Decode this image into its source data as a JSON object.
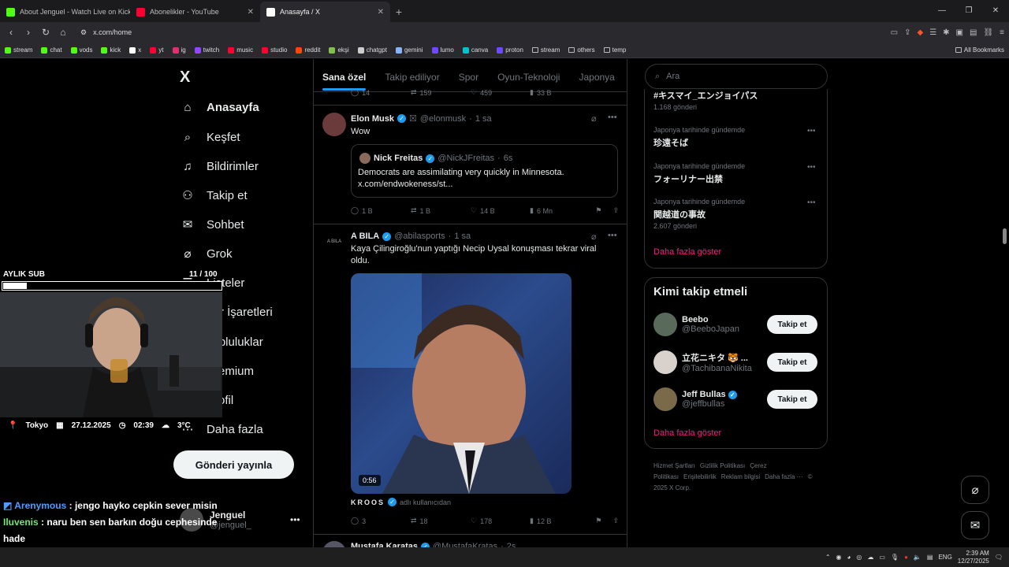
{
  "browser": {
    "tabs": [
      {
        "title": "About Jenguel - Watch Live on Kick",
        "color": "#53fc18"
      },
      {
        "title": "Abonelikler - YouTube",
        "color": "#ff0033"
      },
      {
        "title": "Anasayfa / X",
        "color": "#ffffff"
      }
    ],
    "active_tab_index": 2,
    "url": "x.com/home",
    "bookmarks": [
      {
        "label": "stream",
        "color": "#53fc18"
      },
      {
        "label": "chat",
        "color": "#53fc18"
      },
      {
        "label": "vods",
        "color": "#53fc18"
      },
      {
        "label": "kick",
        "color": "#53fc18"
      },
      {
        "label": "x",
        "color": "#ffffff"
      },
      {
        "label": "yt",
        "color": "#ff0033"
      },
      {
        "label": "ig",
        "color": "#e1306c"
      },
      {
        "label": "twitch",
        "color": "#9146ff"
      },
      {
        "label": "music",
        "color": "#ff0033"
      },
      {
        "label": "studio",
        "color": "#ff0033"
      },
      {
        "label": "reddit",
        "color": "#ff4500"
      },
      {
        "label": "ekşi",
        "color": "#81c14b"
      },
      {
        "label": "chatgpt",
        "color": "#cccccc"
      },
      {
        "label": "gemini",
        "color": "#8ab4f8"
      },
      {
        "label": "lumo",
        "color": "#6d4aff"
      },
      {
        "label": "canva",
        "color": "#00c4cc"
      },
      {
        "label": "proton",
        "color": "#6d4aff"
      }
    ],
    "folders": [
      "stream",
      "others",
      "temp"
    ],
    "all_bookmarks": "All Bookmarks"
  },
  "sidebar": {
    "logo": "X",
    "items": [
      {
        "label": "Anasayfa",
        "icon": "home-icon",
        "glyph": "⌂"
      },
      {
        "label": "Keşfet",
        "icon": "search-icon",
        "glyph": "⌕"
      },
      {
        "label": "Bildirimler",
        "icon": "bell-icon",
        "glyph": "♫"
      },
      {
        "label": "Takip et",
        "icon": "follow-icon",
        "glyph": "⚇"
      },
      {
        "label": "Sohbet",
        "icon": "mail-icon",
        "glyph": "✉"
      },
      {
        "label": "Grok",
        "icon": "grok-icon",
        "glyph": "⌀"
      },
      {
        "label": "Listeler",
        "icon": "list-icon",
        "glyph": "☰"
      },
      {
        "label": "Yer İşaretleri",
        "icon": "bookmark-icon",
        "glyph": "⚑"
      },
      {
        "label": "Topluluklar",
        "icon": "communities-icon",
        "glyph": "⚉"
      },
      {
        "label": "Premium",
        "icon": "premium-icon",
        "glyph": "X"
      },
      {
        "label": "Profil",
        "icon": "profile-icon",
        "glyph": "☺"
      },
      {
        "label": "Daha fazla",
        "icon": "more-icon",
        "glyph": "⋯"
      }
    ],
    "post_button": "Gönderi yayınla",
    "account": {
      "name": "Jenguel",
      "handle": "@jenguel_"
    }
  },
  "feed": {
    "tabs": [
      "Sana özel",
      "Takip ediliyor",
      "Spor",
      "Oyun-Teknoloji",
      "Japonya"
    ],
    "prev_actions": {
      "replies": "14",
      "reposts": "159",
      "likes": "459",
      "views": "33 B"
    },
    "tweets": [
      {
        "name": "Elon Musk",
        "handle": "@elonmusk",
        "time": "1 sa",
        "text": "Wow",
        "quote": {
          "name": "Nick Freitas",
          "handle": "@NickJFreitas",
          "time": "6s",
          "text": "Democrats are assimilating very quickly in Minnesota. x.com/endwokeness/st..."
        },
        "actions": {
          "replies": "1 B",
          "reposts": "1 B",
          "likes": "14 B",
          "views": "6 Mn"
        }
      },
      {
        "name": "A BILA",
        "handle": "@abilasports",
        "time": "1 sa",
        "text": "Kaya Çilingiroğlu'nun yaptığı Necip Uysal konuşması tekrar viral oldu.",
        "video_duration": "0:56",
        "attribution_name": "KROOS",
        "attribution_suffix": "adlı kullanıcıdan",
        "actions": {
          "replies": "3",
          "reposts": "18",
          "likes": "178",
          "views": "12 B"
        }
      },
      {
        "name": "Mustafa Karataş",
        "handle": "@MustafaKratas",
        "time": "2s"
      }
    ]
  },
  "right": {
    "search_placeholder": "Ara",
    "trends": [
      {
        "subtitle": "",
        "title": "#キスマイ_エンジョイパス",
        "count": "1.168 gönderi"
      },
      {
        "subtitle": "Japonya tarihinde gündemde",
        "title": "珍遠そば",
        "count": ""
      },
      {
        "subtitle": "Japonya tarihinde gündemde",
        "title": "フォーリナー出禁",
        "count": ""
      },
      {
        "subtitle": "Japonya tarihinde gündemde",
        "title": "関越道の事故",
        "count": "2.607 gönderi"
      }
    ],
    "show_more": "Daha fazla göster",
    "who_to_follow": {
      "title": "Kimi takip etmeli",
      "users": [
        {
          "name": "Beebo",
          "handle": "@BeeboJapan",
          "verified": false
        },
        {
          "name": "立花ニキタ 🐯 ...",
          "handle": "@TachibanaNikita",
          "verified": false
        },
        {
          "name": "Jeff Bullas",
          "handle": "@jeffbullas",
          "verified": true
        }
      ],
      "follow_label": "Takip et",
      "show_more": "Daha fazla göster"
    },
    "footer": [
      "Hizmet Şartları",
      "Gizlilik Politikası",
      "Çerez Politikası",
      "Erişilebilirlik",
      "Reklam bilgisi",
      "Daha fazla ···",
      "© 2025 X Corp."
    ]
  },
  "stream_overlay": {
    "sub_label": "AYLIK SUB",
    "sub_count": "11 / 100",
    "sub_progress": 0.11,
    "location": "Tokyo",
    "date": "27.12.2025",
    "time": "02:39",
    "temp": "3°C",
    "chat": [
      {
        "user": "Arenymous",
        "message": ": jengo hayko cepkin sever misin"
      },
      {
        "user": "Iluvenis",
        "message": ": naru ben sen barkın doğu cephesinde hade"
      }
    ]
  },
  "taskbar": {
    "lang": "ENG",
    "time": "2:39 AM",
    "date": "12/27/2025"
  },
  "colors": {
    "accent": "#1d9bf0",
    "pink": "#f91880",
    "bg": "#000000",
    "border": "#2f3336"
  }
}
